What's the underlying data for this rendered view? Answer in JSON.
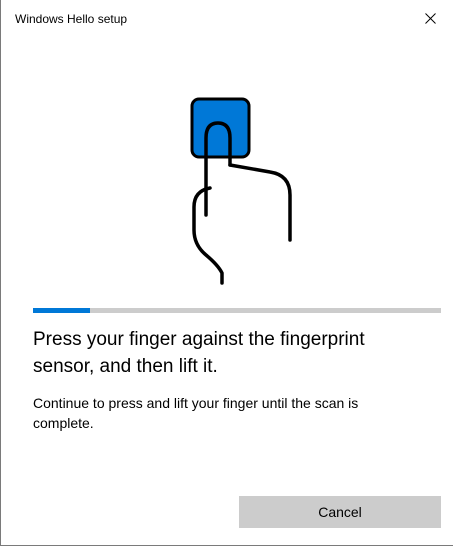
{
  "window": {
    "title": "Windows Hello setup"
  },
  "titlebar": {
    "close_icon": "close-icon"
  },
  "illustration": {
    "icon": "fingerprint-touch-icon",
    "sensor_color": "#0078d7"
  },
  "progress": {
    "fraction": 0.14,
    "fill_color": "#0078d7",
    "track_color": "#cccccc"
  },
  "content": {
    "heading": "Press your finger against the fingerprint sensor, and then lift it.",
    "body": "Continue to press and lift your finger until the scan is complete."
  },
  "buttons": {
    "cancel_label": "Cancel"
  }
}
